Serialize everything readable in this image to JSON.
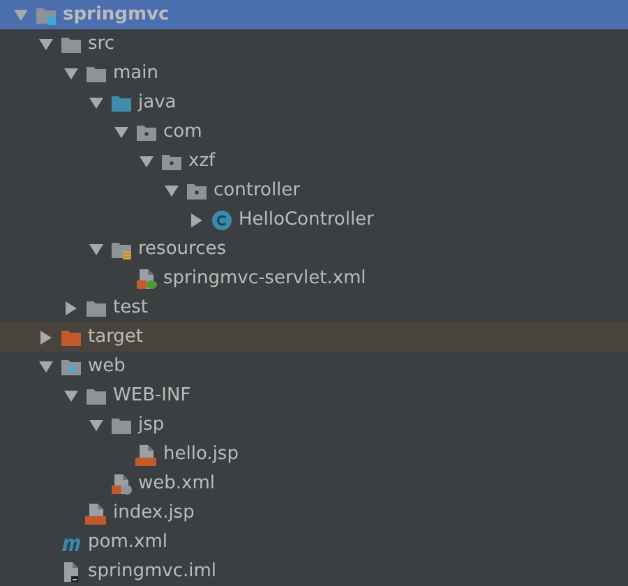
{
  "project_tree": [
    {
      "name": "springmvc",
      "kind": "module",
      "expanded": true,
      "selected": true,
      "children": [
        {
          "name": "src",
          "kind": "folder",
          "expanded": true,
          "selected": false,
          "children": [
            {
              "name": "main",
              "kind": "folder",
              "expanded": true,
              "selected": false,
              "children": [
                {
                  "name": "java",
                  "kind": "source-folder",
                  "expanded": true,
                  "selected": false,
                  "children": [
                    {
                      "name": "com",
                      "kind": "package",
                      "expanded": true,
                      "selected": false,
                      "children": [
                        {
                          "name": "xzf",
                          "kind": "package",
                          "expanded": true,
                          "selected": false,
                          "children": [
                            {
                              "name": "controller",
                              "kind": "package",
                              "expanded": true,
                              "selected": false,
                              "children": [
                                {
                                  "name": "HelloController",
                                  "kind": "class",
                                  "expanded": false,
                                  "selected": false
                                }
                              ]
                            }
                          ]
                        }
                      ]
                    }
                  ]
                },
                {
                  "name": "resources",
                  "kind": "resource-folder",
                  "expanded": true,
                  "selected": false,
                  "children": [
                    {
                      "name": "springmvc-servlet.xml",
                      "kind": "spring-xml",
                      "selected": false
                    }
                  ]
                }
              ]
            },
            {
              "name": "test",
              "kind": "folder",
              "expanded": false,
              "selected": false
            }
          ]
        },
        {
          "name": "target",
          "kind": "excluded-folder",
          "expanded": false,
          "selected": false
        },
        {
          "name": "web",
          "kind": "web-folder",
          "expanded": true,
          "selected": false,
          "children": [
            {
              "name": "WEB-INF",
              "kind": "folder",
              "expanded": true,
              "selected": false,
              "children": [
                {
                  "name": "jsp",
                  "kind": "folder",
                  "expanded": true,
                  "selected": false,
                  "children": [
                    {
                      "name": "hello.jsp",
                      "kind": "jsp",
                      "selected": false
                    }
                  ]
                },
                {
                  "name": "web.xml",
                  "kind": "web-xml",
                  "selected": false
                }
              ]
            },
            {
              "name": "index.jsp",
              "kind": "jsp",
              "selected": false
            }
          ]
        },
        {
          "name": "pom.xml",
          "kind": "maven",
          "selected": false
        },
        {
          "name": "springmvc.iml",
          "kind": "iml",
          "selected": false
        }
      ]
    }
  ]
}
